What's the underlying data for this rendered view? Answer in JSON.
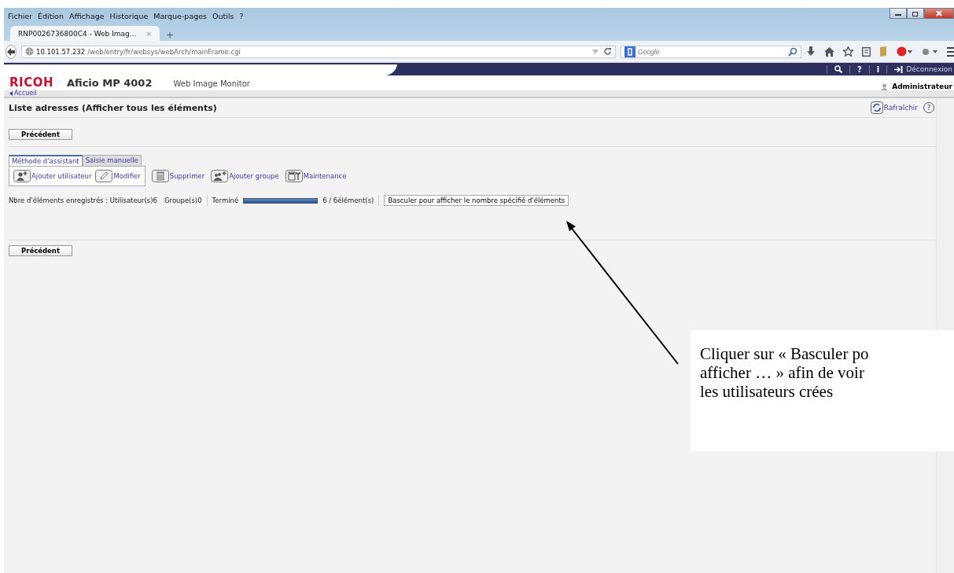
{
  "browser": {
    "menu": [
      "Fichier",
      "Édition",
      "Affichage",
      "Historique",
      "Marque-pages",
      "Outils",
      "?"
    ],
    "tab": {
      "title": "RNP0026736800C4 - Web Imag...",
      "close": "×",
      "selected": true
    },
    "new_tab": "+",
    "address": {
      "host": "10.101.57.232",
      "path": "/web/entry/fr/websys/webArch/mainFrame.cgi"
    },
    "search": {
      "placeholder": "Google"
    }
  },
  "header": {
    "brand": "RICOH",
    "model": "Aficio MP 4002",
    "product": "Web Image Monitor",
    "top_links": [
      {
        "kind": "search"
      },
      {
        "kind": "text",
        "label": "?"
      },
      {
        "kind": "text",
        "label": "i"
      },
      {
        "kind": "logout",
        "label": "Déconnexion"
      }
    ],
    "user": "Administrateur"
  },
  "breadcrumb": "Accueil",
  "page": {
    "title": "Liste adresses (Afficher tous les éléments)",
    "refresh": "Rafraîchir",
    "help": "?",
    "back_top": "Précédent",
    "back_bottom": "Précédent",
    "tabs": [
      {
        "label": "Méthode d'assistant",
        "selected": true
      },
      {
        "label": "Saisie manuelle",
        "selected": false
      }
    ],
    "panel_actions": [
      {
        "kind": "add-user",
        "label": "Ajouter utilisateur"
      },
      {
        "kind": "edit",
        "label": "Modifier"
      }
    ],
    "actions": [
      {
        "kind": "delete",
        "label": "Supprimer"
      },
      {
        "kind": "add-group",
        "label": "Ajouter groupe"
      },
      {
        "kind": "maintenance",
        "label": "Maintenance"
      }
    ],
    "registered": "Nbre d'éléments enregistrés : Utilisateur(s)6",
    "groups": "Groupe(s)0",
    "progress": {
      "label": "Terminé",
      "level": 1,
      "count": "6 / 6élément(s)"
    },
    "switch_button": "Basculer pour afficher le nombre spécifié d'éléments"
  },
  "callout": {
    "lines": [
      "Cliquer sur « Basculer po",
      "afficher … » afin de voir",
      "les utilisateurs crées"
    ]
  }
}
